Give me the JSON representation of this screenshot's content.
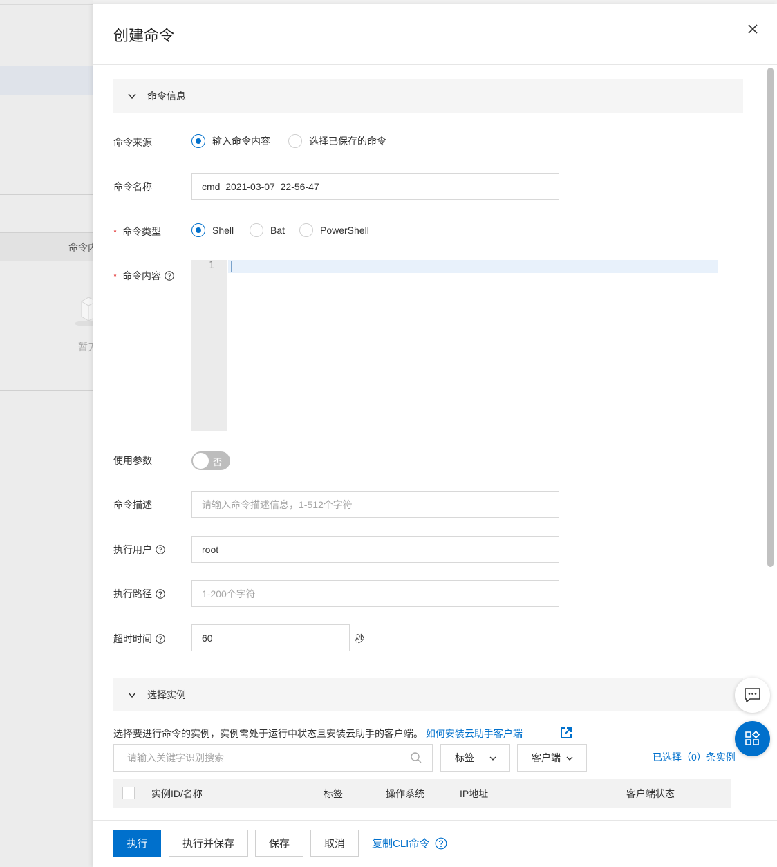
{
  "background": {
    "column_header": "命令内",
    "empty_text": "暂无"
  },
  "drawer": {
    "title": "创建命令"
  },
  "section_command": {
    "title": "命令信息"
  },
  "fields": {
    "source": {
      "label": "命令来源",
      "options": [
        "输入命令内容",
        "选择已保存的命令"
      ],
      "selected": "输入命令内容"
    },
    "name": {
      "label": "命令名称",
      "value": "cmd_2021-03-07_22-56-47"
    },
    "type": {
      "label": "命令类型",
      "required_mark": "*",
      "options": [
        "Shell",
        "Bat",
        "PowerShell"
      ],
      "selected": "Shell"
    },
    "content": {
      "label": "命令内容",
      "required_mark": "*",
      "line_number": "1",
      "value": ""
    },
    "use_params": {
      "label": "使用参数",
      "toggle_text": "否",
      "enabled": false
    },
    "description": {
      "label": "命令描述",
      "value": "",
      "placeholder": "请输入命令描述信息，1-512个字符"
    },
    "exec_user": {
      "label": "执行用户",
      "value": "root"
    },
    "exec_path": {
      "label": "执行路径",
      "value": "",
      "placeholder": "1-200个字符"
    },
    "timeout": {
      "label": "超时时间",
      "value": "60",
      "unit": "秒"
    }
  },
  "section_instances": {
    "title": "选择实例",
    "description": "选择要进行命令的实例，实例需处于运行中状态且安装云助手的客户端。",
    "install_link": "如何安装云助手客户端",
    "search_placeholder": "请输入关键字识别搜索",
    "filter_tag": "标签",
    "filter_client": "客户端",
    "selected_count_text": "已选择（0）条实例",
    "table_columns": [
      "实例ID/名称",
      "标签",
      "操作系统",
      "IP地址",
      "客户端状态"
    ]
  },
  "footer": {
    "execute": "执行",
    "execute_save": "执行并保存",
    "save": "保存",
    "cancel": "取消",
    "copy_cli": "复制CLI命令"
  },
  "colors": {
    "primary": "#0070cc",
    "required": "#e23030"
  }
}
